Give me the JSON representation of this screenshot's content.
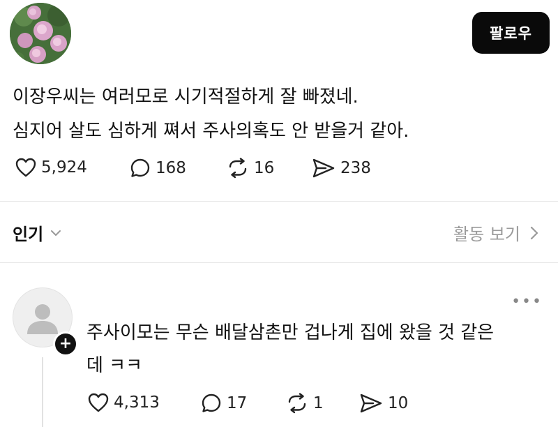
{
  "post": {
    "follow_label": "팔로우",
    "text_lines": [
      "이장우씨는 여러모로 시기적절하게 잘 빠졌네.",
      "심지어 살도 심하게 쪄서 주사의혹도 안 받을거 같아."
    ],
    "stats": {
      "likes": "5,924",
      "comments": "168",
      "reposts": "16",
      "shares": "238"
    }
  },
  "filter": {
    "sort_label": "인기",
    "activity_label": "활동 보기"
  },
  "reply": {
    "text_lines": [
      "주사이모는 무슨 배달삼촌만 겁나게 집에 왔을 것 같은",
      "데 ㅋㅋ"
    ],
    "stats": {
      "likes": "4,313",
      "comments": "17",
      "reposts": "1",
      "shares": "10"
    }
  },
  "icons": [
    "flower-avatar",
    "heart-icon",
    "comment-icon",
    "repost-icon",
    "share-icon",
    "chevron-down-icon",
    "chevron-right-icon",
    "more-icon",
    "default-avatar",
    "plus-icon"
  ]
}
